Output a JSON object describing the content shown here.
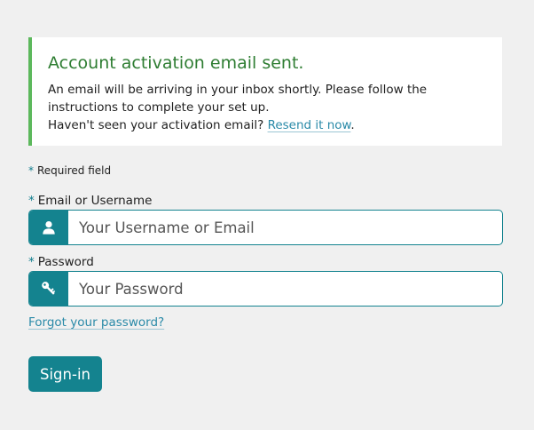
{
  "notice": {
    "title": "Account activation email sent.",
    "body_line1": "An email will be arriving in your inbox shortly. Please follow the instructions to complete your set up.",
    "body_line2_prefix": "Haven't seen your activation email?",
    "resend_link": "Resend it now",
    "body_line2_suffix": ".",
    "accent_color": "#5cb85c",
    "title_color": "#2e7d32"
  },
  "form": {
    "required_marker": "*",
    "required_note": "Required field",
    "email_label": "Email or Username",
    "email_placeholder": "Your Username or Email",
    "email_value": "",
    "email_icon": "user-icon",
    "password_label": "Password",
    "password_placeholder": "Your Password",
    "password_value": "",
    "password_icon": "key-icon",
    "forgot_link": "Forgot your password?",
    "submit_label": "Sign-in",
    "primary_color": "#14838f",
    "link_color": "#2a8aa8"
  }
}
